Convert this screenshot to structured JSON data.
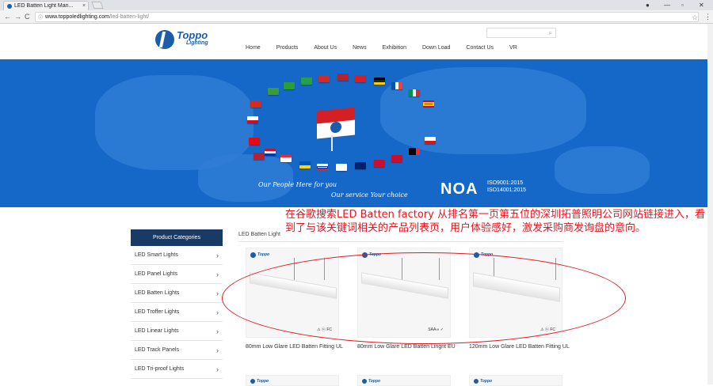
{
  "browser": {
    "tab_title": "LED Batten Light Man...",
    "tab_close": "×",
    "window_controls": {
      "account": "●",
      "minimize": "—",
      "restore": "▫",
      "close": "✕"
    },
    "url_host": "www.toppoledlighting.com",
    "url_path": "/led-batten-light/",
    "back": "←",
    "forward": "→",
    "reload": "C",
    "star": "☆",
    "menu": "⋮"
  },
  "site": {
    "logo_main": "Toppo",
    "logo_sub": "Lighting",
    "nav": [
      "Home",
      "Products",
      "About Us",
      "News",
      "Exhibition",
      "Down Load",
      "Contact Us",
      "VR"
    ],
    "search_icon": "magnifier-icon"
  },
  "banner": {
    "text_left": "Our People Here for you",
    "text_right": "Our service Your choice",
    "brand": "NOA",
    "iso_1": "ISO9001:2015",
    "iso_2": "ISO14001:2015"
  },
  "annotation": {
    "text": "在谷歌搜索LED Batten factory 从排名第一页第五位的深圳拓普照明公司网站链接进入，看到了与该关键词相关的产品列表页，用户体验感好，激发采购商发询盘的意向。",
    "color": "#e8151f"
  },
  "sidebar": {
    "heading": "Product Categories",
    "items": [
      "LED Smart Lights",
      "LED Panel Lights",
      "LED Batten Lights",
      "LED Troffer Lights",
      "LED Linear Lights",
      "LED Track Panels",
      "LED Tri-proof Lights"
    ],
    "chevron": "›"
  },
  "breadcrumb": "LED Batten Light",
  "products": [
    {
      "title": "80mm Low Glare LED Batten Fitting UL",
      "brand": "Toppo",
      "certs": "⚠ ⓤ FC"
    },
    {
      "title": "80mm Low Glare LED Batten Lingnt EU",
      "brand": "Toppo",
      "certs": "SAA ℮ ✓"
    },
    {
      "title": "120mm Low Glare LED Batten Fitting UL",
      "brand": "Toppo",
      "certs": "⚠ ⓤ FC"
    }
  ],
  "products_row2": [
    {
      "brand": "Toppo"
    },
    {
      "brand": "Toppo"
    },
    {
      "brand": "Toppo"
    }
  ],
  "colors": {
    "brand_blue": "#1b5dab",
    "banner_blue": "#1568c8",
    "sidebar_head": "#1a3a66"
  }
}
